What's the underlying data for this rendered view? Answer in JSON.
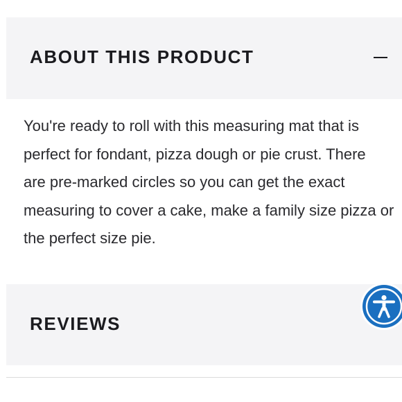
{
  "about_section": {
    "title": "ABOUT THIS PRODUCT",
    "toggle_icon": "minus-icon",
    "description_lines": [
      "You're ready to roll with this measuring mat that is",
      "perfect for fondant, pizza dough or pie crust. There",
      "are pre-marked circles so you can get the exact",
      "measuring to cover a cake, make a family size pizza or",
      "the perfect size pie."
    ]
  },
  "reviews_section": {
    "title": "REVIEWS"
  },
  "accessibility_widget": {
    "icon": "accessibility-person-icon",
    "color": "#1a6fc0"
  },
  "colors": {
    "header_bg": "#f4f4f6",
    "text": "#1b1b1f"
  }
}
